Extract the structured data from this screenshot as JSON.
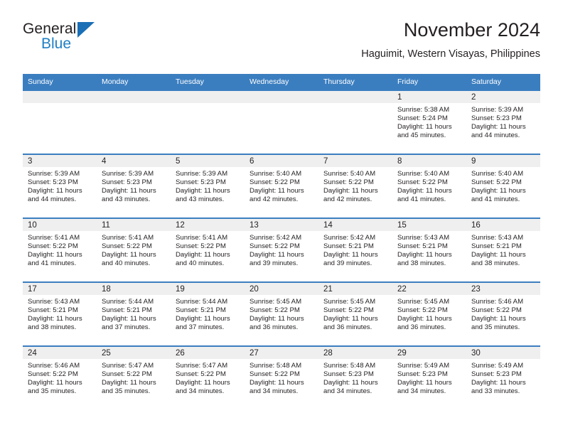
{
  "brand": {
    "word1": "General",
    "word2": "Blue",
    "triangle_color": "#1b6fb5",
    "blue_color": "#1f7fc4"
  },
  "header": {
    "title": "November 2024",
    "subtitle": "Haguimit, Western Visayas, Philippines"
  },
  "theme": {
    "header_blue": "#3b7ec0",
    "daynum_gray": "#efefef",
    "text": "#231f20"
  },
  "calendar": {
    "weekdays": [
      "Sunday",
      "Monday",
      "Tuesday",
      "Wednesday",
      "Thursday",
      "Friday",
      "Saturday"
    ],
    "weeks": [
      [
        {
          "day": "",
          "lines": []
        },
        {
          "day": "",
          "lines": []
        },
        {
          "day": "",
          "lines": []
        },
        {
          "day": "",
          "lines": []
        },
        {
          "day": "",
          "lines": []
        },
        {
          "day": "1",
          "lines": [
            "Sunrise: 5:38 AM",
            "Sunset: 5:24 PM",
            "Daylight: 11 hours and 45 minutes."
          ]
        },
        {
          "day": "2",
          "lines": [
            "Sunrise: 5:39 AM",
            "Sunset: 5:23 PM",
            "Daylight: 11 hours and 44 minutes."
          ]
        }
      ],
      [
        {
          "day": "3",
          "lines": [
            "Sunrise: 5:39 AM",
            "Sunset: 5:23 PM",
            "Daylight: 11 hours and 44 minutes."
          ]
        },
        {
          "day": "4",
          "lines": [
            "Sunrise: 5:39 AM",
            "Sunset: 5:23 PM",
            "Daylight: 11 hours and 43 minutes."
          ]
        },
        {
          "day": "5",
          "lines": [
            "Sunrise: 5:39 AM",
            "Sunset: 5:23 PM",
            "Daylight: 11 hours and 43 minutes."
          ]
        },
        {
          "day": "6",
          "lines": [
            "Sunrise: 5:40 AM",
            "Sunset: 5:22 PM",
            "Daylight: 11 hours and 42 minutes."
          ]
        },
        {
          "day": "7",
          "lines": [
            "Sunrise: 5:40 AM",
            "Sunset: 5:22 PM",
            "Daylight: 11 hours and 42 minutes."
          ]
        },
        {
          "day": "8",
          "lines": [
            "Sunrise: 5:40 AM",
            "Sunset: 5:22 PM",
            "Daylight: 11 hours and 41 minutes."
          ]
        },
        {
          "day": "9",
          "lines": [
            "Sunrise: 5:40 AM",
            "Sunset: 5:22 PM",
            "Daylight: 11 hours and 41 minutes."
          ]
        }
      ],
      [
        {
          "day": "10",
          "lines": [
            "Sunrise: 5:41 AM",
            "Sunset: 5:22 PM",
            "Daylight: 11 hours and 41 minutes."
          ]
        },
        {
          "day": "11",
          "lines": [
            "Sunrise: 5:41 AM",
            "Sunset: 5:22 PM",
            "Daylight: 11 hours and 40 minutes."
          ]
        },
        {
          "day": "12",
          "lines": [
            "Sunrise: 5:41 AM",
            "Sunset: 5:22 PM",
            "Daylight: 11 hours and 40 minutes."
          ]
        },
        {
          "day": "13",
          "lines": [
            "Sunrise: 5:42 AM",
            "Sunset: 5:22 PM",
            "Daylight: 11 hours and 39 minutes."
          ]
        },
        {
          "day": "14",
          "lines": [
            "Sunrise: 5:42 AM",
            "Sunset: 5:21 PM",
            "Daylight: 11 hours and 39 minutes."
          ]
        },
        {
          "day": "15",
          "lines": [
            "Sunrise: 5:43 AM",
            "Sunset: 5:21 PM",
            "Daylight: 11 hours and 38 minutes."
          ]
        },
        {
          "day": "16",
          "lines": [
            "Sunrise: 5:43 AM",
            "Sunset: 5:21 PM",
            "Daylight: 11 hours and 38 minutes."
          ]
        }
      ],
      [
        {
          "day": "17",
          "lines": [
            "Sunrise: 5:43 AM",
            "Sunset: 5:21 PM",
            "Daylight: 11 hours and 38 minutes."
          ]
        },
        {
          "day": "18",
          "lines": [
            "Sunrise: 5:44 AM",
            "Sunset: 5:21 PM",
            "Daylight: 11 hours and 37 minutes."
          ]
        },
        {
          "day": "19",
          "lines": [
            "Sunrise: 5:44 AM",
            "Sunset: 5:21 PM",
            "Daylight: 11 hours and 37 minutes."
          ]
        },
        {
          "day": "20",
          "lines": [
            "Sunrise: 5:45 AM",
            "Sunset: 5:22 PM",
            "Daylight: 11 hours and 36 minutes."
          ]
        },
        {
          "day": "21",
          "lines": [
            "Sunrise: 5:45 AM",
            "Sunset: 5:22 PM",
            "Daylight: 11 hours and 36 minutes."
          ]
        },
        {
          "day": "22",
          "lines": [
            "Sunrise: 5:45 AM",
            "Sunset: 5:22 PM",
            "Daylight: 11 hours and 36 minutes."
          ]
        },
        {
          "day": "23",
          "lines": [
            "Sunrise: 5:46 AM",
            "Sunset: 5:22 PM",
            "Daylight: 11 hours and 35 minutes."
          ]
        }
      ],
      [
        {
          "day": "24",
          "lines": [
            "Sunrise: 5:46 AM",
            "Sunset: 5:22 PM",
            "Daylight: 11 hours and 35 minutes."
          ]
        },
        {
          "day": "25",
          "lines": [
            "Sunrise: 5:47 AM",
            "Sunset: 5:22 PM",
            "Daylight: 11 hours and 35 minutes."
          ]
        },
        {
          "day": "26",
          "lines": [
            "Sunrise: 5:47 AM",
            "Sunset: 5:22 PM",
            "Daylight: 11 hours and 34 minutes."
          ]
        },
        {
          "day": "27",
          "lines": [
            "Sunrise: 5:48 AM",
            "Sunset: 5:22 PM",
            "Daylight: 11 hours and 34 minutes."
          ]
        },
        {
          "day": "28",
          "lines": [
            "Sunrise: 5:48 AM",
            "Sunset: 5:23 PM",
            "Daylight: 11 hours and 34 minutes."
          ]
        },
        {
          "day": "29",
          "lines": [
            "Sunrise: 5:49 AM",
            "Sunset: 5:23 PM",
            "Daylight: 11 hours and 34 minutes."
          ]
        },
        {
          "day": "30",
          "lines": [
            "Sunrise: 5:49 AM",
            "Sunset: 5:23 PM",
            "Daylight: 11 hours and 33 minutes."
          ]
        }
      ]
    ]
  }
}
